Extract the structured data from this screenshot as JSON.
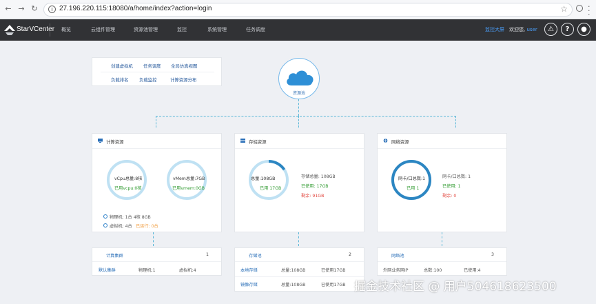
{
  "browser": {
    "url": "27.196.220.115:18080/a/home/index?action=login"
  },
  "app": {
    "brand": "StarVCenter",
    "nav": [
      "概览",
      "云组件管理",
      "资源池管理",
      "监控",
      "系统管理",
      "任务调度"
    ],
    "big_screen": "监控大屏",
    "welcome": "欢迎您,",
    "user": "user",
    "icons": [
      "warning-icon",
      "help-icon",
      "user-icon"
    ]
  },
  "quick_menu": {
    "row1": [
      "创建虚拟机",
      "任务调度",
      "全局仿真视图"
    ],
    "row2": [
      "负载排名",
      "负载监控",
      "计算资源分布"
    ]
  },
  "pool": {
    "label": "资源池"
  },
  "compute": {
    "title": "计算资源",
    "vcpu_total": "vCpu总量:8核",
    "vcpu_used": "已用vcpu:0核",
    "vmem_total": "vMem总量:7GB",
    "vmem_used": "已用vmem:0GB",
    "physical": "物理机: 1台 4核 8GB",
    "vm_prefix": "虚拟机: 4台",
    "vm_running": "已运行: 0台"
  },
  "storage": {
    "title": "存储资源",
    "ring_total": "总量:108GB",
    "ring_used": "已用 17GB",
    "used_fraction": 0.157,
    "total": "存储总量: 108GB",
    "used": "已使用: 17GB",
    "remaining": "剩余: 91GB"
  },
  "network": {
    "title": "网络资源",
    "ring_total": "网卡/口总数:1",
    "ring_used": "已用 1",
    "used_fraction": 1.0,
    "total": "网卡/口总数: 1",
    "used": "已使用: 1",
    "remaining": "剩余: 0"
  },
  "compute_table": {
    "head": "计算集群",
    "count": "1",
    "row": [
      "默认集群",
      "物理机:1",
      "虚拟机:4"
    ]
  },
  "storage_table": {
    "head": "存储池",
    "count": "2",
    "rows": [
      [
        "本地存储",
        "总量:108GB",
        "已使用17GB"
      ],
      [
        "镜像存储",
        "总量:108GB",
        "已使用17GB"
      ]
    ]
  },
  "network_table": {
    "head": "网络池",
    "count": "3",
    "row": [
      "外网业务网IP",
      "总数:100",
      "已使用:4"
    ]
  },
  "watermark": "掘金技术社区 @ 用户504618623500",
  "colors": {
    "header_bg": "#313235",
    "accent_blue": "#2a6fb8",
    "ring_light": "#bfe1f3",
    "ring_dark": "#2c86c2",
    "green": "#2f9a2f",
    "red": "#e2473f",
    "orange": "#f09b3c"
  }
}
